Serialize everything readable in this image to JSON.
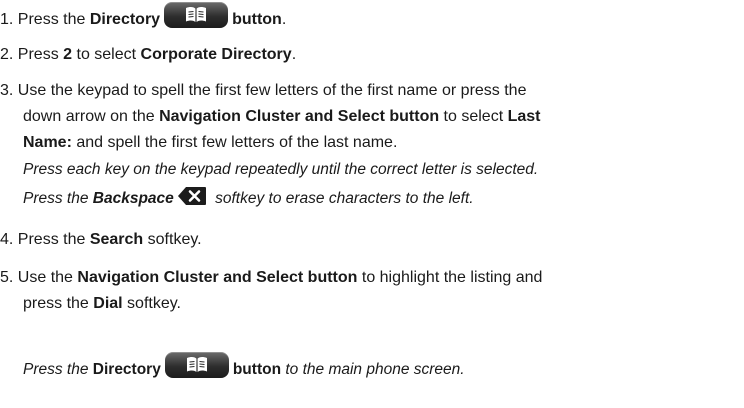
{
  "steps": [
    {
      "num": "1.",
      "pre": "Press the ",
      "bold1": "Directory",
      "icon": "book-icon",
      "bold2": "button",
      "post": "."
    },
    {
      "num": "2.",
      "pre": "Press ",
      "bold1": "2",
      "mid": " to select ",
      "bold2": "Corporate Directory",
      "post": "."
    },
    {
      "num": "3.",
      "line1": "Use the keypad to spell the first few letters of the  first name or press the",
      "line2_pre": "down arrow on the ",
      "line2_bold1": "Navigation Cluster and Select button",
      "line2_mid": " to select ",
      "line2_bold2": "Last",
      "line3_bold": "Name:",
      "line3_post": " and spell the first few letters of the last name.",
      "note1": "Press each key on the keypad repeatedly until the correct letter is selected.",
      "note2_pre": "Press the ",
      "note2_bold": "Backspace",
      "note2_icon": "backspace-icon",
      "note2_post": " softkey to erase characters to the left."
    },
    {
      "num": "4.",
      "pre": "Press the ",
      "bold1": "Search",
      "post": " softkey."
    },
    {
      "num": "5.",
      "pre": "Use the ",
      "bold1": "Navigation Cluster and Select button",
      "mid": " to highlight the listing and",
      "line2_pre": "press the ",
      "line2_bold": "Dial",
      "line2_post": " softkey."
    }
  ],
  "footer": {
    "pre": "Press the ",
    "bold1": "Directory",
    "icon": "book-icon",
    "bold2": "button",
    "post": " to the main phone screen."
  }
}
